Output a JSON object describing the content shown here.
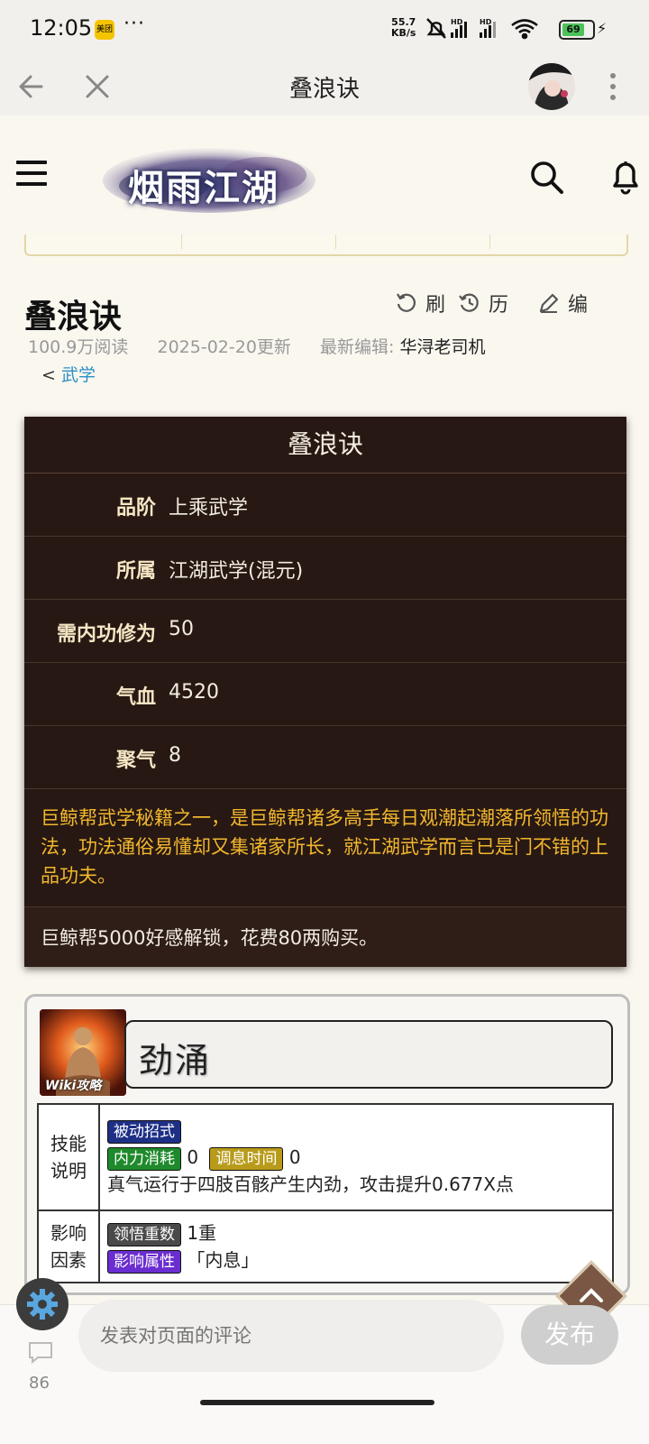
{
  "status_bar": {
    "time": "12:05",
    "app_badge": "美团",
    "more": "···",
    "net_speed_value": "55.7",
    "net_speed_unit": "KB/s",
    "battery": "69"
  },
  "nav": {
    "title": "叠浪诀"
  },
  "site": {
    "logo_text": "烟雨江湖"
  },
  "page": {
    "title": "叠浪诀",
    "actions": {
      "refresh": "刷",
      "history": "历",
      "edit": "编"
    },
    "views": "100.9万阅读",
    "updated": "2025-02-20更新",
    "editor_label": "最新编辑:",
    "editor_name": "华浔老司机",
    "breadcrumb_prefix": "<",
    "breadcrumb_link": "武学"
  },
  "infobox": {
    "title": "叠浪诀",
    "rows": [
      {
        "label": "品阶",
        "value": "上乘武学"
      },
      {
        "label": "所属",
        "value": "江湖武学(混元)"
      },
      {
        "label": "需内功修为",
        "value": "50"
      },
      {
        "label": "气血",
        "value": "4520"
      },
      {
        "label": "聚气",
        "value": "8"
      }
    ],
    "description": "巨鲸帮武学秘籍之一，是巨鲸帮诸多高手每日观潮起潮落所领悟的功法，功法通俗易懂却又集诸家所长，就江湖武学而言已是门不错的上品功夫。",
    "unlock_note": "巨鲸帮5000好感解锁，花费80两购买。"
  },
  "skill": {
    "name": "劲涌",
    "icon_caption": "Wiki攻略",
    "desc_label": "技能说明",
    "tag_type": "被动招式",
    "tag_cost": "内力消耗",
    "cost_value": "0",
    "tag_cooldown": "调息时间",
    "cooldown_value": "0",
    "effect": "真气运行于四肢百骸产生内劲，攻击提升0.677X点",
    "factor_label": "影响因素",
    "tag_levels": "领悟重数",
    "levels_value": "1重",
    "tag_attr": "影响属性",
    "attr_value": "「内息」"
  },
  "bottom": {
    "comment_count": "86",
    "comment_placeholder": "发表对页面的评论",
    "publish_label": "发布"
  }
}
